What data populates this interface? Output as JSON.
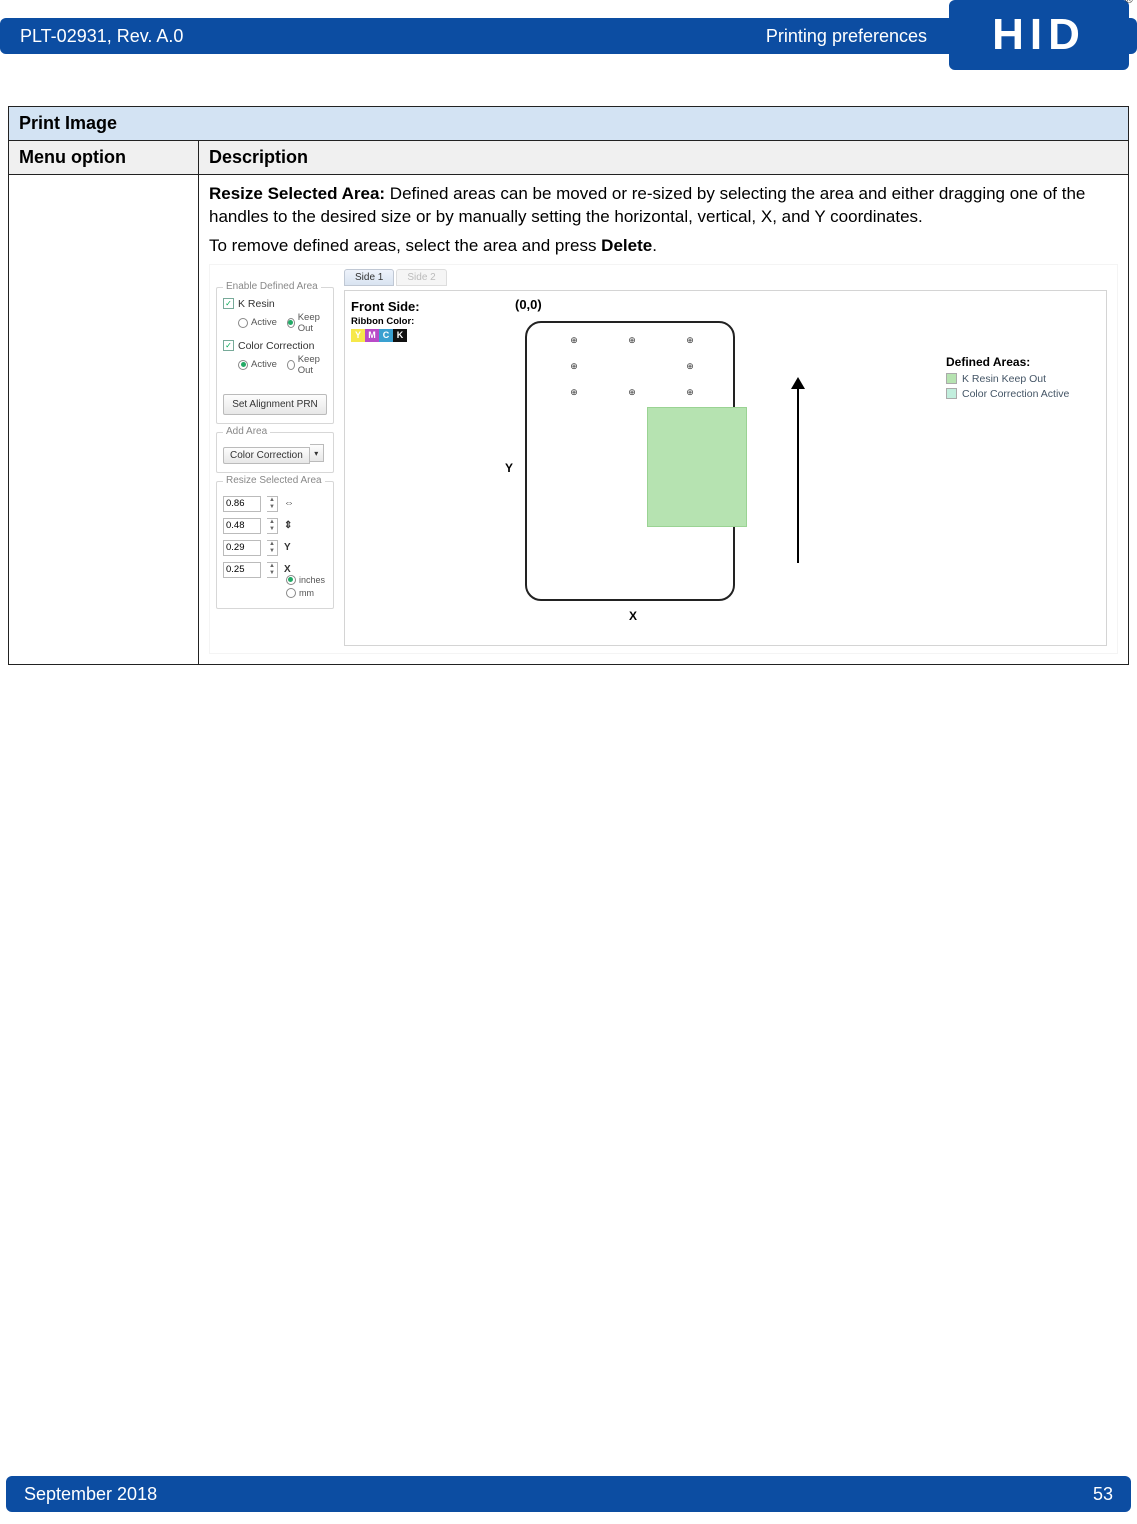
{
  "header": {
    "doc_id": "PLT-02931, Rev. A.0",
    "section": "Printing preferences",
    "logo_text": "HID",
    "registered": "®"
  },
  "table": {
    "title": "Print Image",
    "col1": "Menu option",
    "col2": "Description",
    "body": {
      "resize_bold": "Resize Selected Area:",
      "resize_text": " Defined areas can be moved or re-sized by selecting the area and either dragging one of the handles to the desired size or by manually setting the horizontal, vertical, X, and Y coordinates.",
      "remove_pre": "To remove defined areas, select the area and press ",
      "remove_bold": "Delete",
      "remove_post": "."
    }
  },
  "ui": {
    "tab1": "Side 1",
    "tab2": "Side 2",
    "front_side": "Front Side:",
    "ribbon_label": "Ribbon Color:",
    "origin": "(0,0)",
    "y_label": "Y",
    "x_label": "X",
    "defined_title": "Defined Areas:",
    "legend1": "K Resin Keep Out",
    "legend2": "Color Correction Active",
    "left": {
      "enable_title": "Enable Defined Area",
      "k_resin": "K Resin",
      "active": "Active",
      "keep_out": "Keep Out",
      "color_corr": "Color Correction",
      "set_align_btn": "Set Alignment PRN",
      "add_area_title": "Add Area",
      "add_area_val": "Color Correction",
      "resize_title": "Resize Selected Area",
      "v1": "0.86",
      "v2": "0.48",
      "v3": "0.29",
      "v4": "0.25",
      "ico1": "⇔",
      "ico2": "⇕",
      "ico3": "Y",
      "ico4": "X",
      "unit_in": "inches",
      "unit_mm": "mm"
    }
  },
  "footer": {
    "date": "September 2018",
    "page": "53"
  }
}
